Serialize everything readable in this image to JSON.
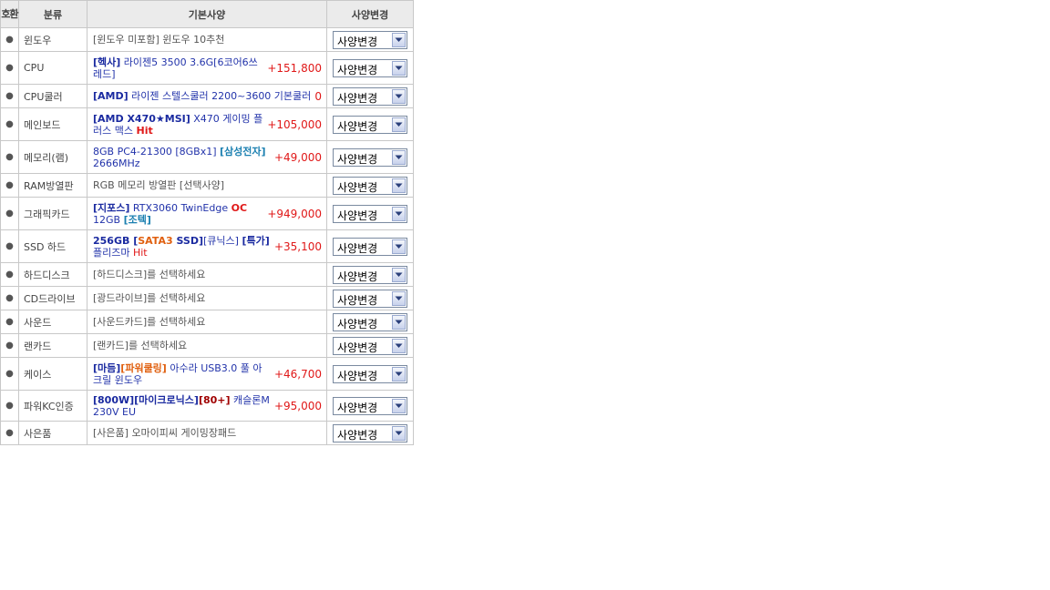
{
  "header": {
    "compat": "호환",
    "category": "분류",
    "spec": "기본사양",
    "change": "사양변경"
  },
  "dropdown_label": "사양변경",
  "bullet": "●",
  "rows": [
    {
      "category": "윈도우",
      "parts": [
        {
          "t": "[윈도우 미포함] 윈도우 10추천",
          "c": "gray"
        }
      ],
      "price": ""
    },
    {
      "category": "CPU",
      "parts": [
        {
          "t": "[헥사]",
          "c": "navy b"
        },
        {
          "t": " 라이젠5 3500 3.6G[6코어6쓰레드]",
          "c": ""
        }
      ],
      "price": "+151,800"
    },
    {
      "category": "CPU쿨러",
      "parts": [
        {
          "t": "[AMD]",
          "c": "navy b"
        },
        {
          "t": " 라이젠 스텔스쿨러 2200~3600 기본쿨러",
          "c": ""
        }
      ],
      "price": "0"
    },
    {
      "category": "메인보드",
      "parts": [
        {
          "t": "[AMD X470",
          "c": "navy b"
        },
        {
          "t": "★",
          "c": "navy"
        },
        {
          "t": "MSI]",
          "c": "navy b"
        },
        {
          "t": " X470 게이밍 플러스 맥스 ",
          "c": ""
        },
        {
          "t": "Hit",
          "c": "red b"
        }
      ],
      "price": "+105,000"
    },
    {
      "category": "메모리(램)",
      "parts": [
        {
          "t": "8GB PC4-21300 [8GBx1] ",
          "c": ""
        },
        {
          "t": "[삼성전자]",
          "c": "teal b"
        },
        {
          "t": " 2666MHz",
          "c": ""
        }
      ],
      "price": "+49,000"
    },
    {
      "category": "RAM방열판",
      "parts": [
        {
          "t": "RGB 메모리 방열판 [선택사양]",
          "c": "gray"
        }
      ],
      "price": ""
    },
    {
      "category": "그래픽카드",
      "parts": [
        {
          "t": "[지포스]",
          "c": "navy b"
        },
        {
          "t": " RTX3060 TwinEdge ",
          "c": ""
        },
        {
          "t": "OC",
          "c": "red b"
        },
        {
          "t": " 12GB ",
          "c": ""
        },
        {
          "t": "[조텍]",
          "c": "teal b"
        }
      ],
      "price": "+949,000"
    },
    {
      "category": "SSD 하드",
      "parts": [
        {
          "t": "256GB [",
          "c": "navy b"
        },
        {
          "t": "SATA3",
          "c": "orange b"
        },
        {
          "t": " SSD]",
          "c": "navy b"
        },
        {
          "t": "[큐닉스] ",
          "c": ""
        },
        {
          "t": "[특가]",
          "c": "navy b"
        },
        {
          "t": " 플리즈마 ",
          "c": ""
        },
        {
          "t": "Hit",
          "c": "red"
        }
      ],
      "price": "+35,100"
    },
    {
      "category": "하드디스크",
      "parts": [
        {
          "t": "[하드디스크]를 선택하세요",
          "c": "gray"
        }
      ],
      "price": ""
    },
    {
      "category": "CD드라이브",
      "parts": [
        {
          "t": "[광드라이브]를 선택하세요",
          "c": "gray"
        }
      ],
      "price": ""
    },
    {
      "category": "사운드",
      "parts": [
        {
          "t": "[사운드카드]를 선택하세요",
          "c": "gray"
        }
      ],
      "price": ""
    },
    {
      "category": "랜카드",
      "parts": [
        {
          "t": "[랜카드]를 선택하세요",
          "c": "gray"
        }
      ],
      "price": ""
    },
    {
      "category": "케이스",
      "parts": [
        {
          "t": "[마듬]",
          "c": "navy b"
        },
        {
          "t": "[파워쿨링]",
          "c": "orange b"
        },
        {
          "t": " 아수라 USB3.0 풀 아크릴 윈도우",
          "c": ""
        }
      ],
      "price": "+46,700"
    },
    {
      "category": "파워KC인증",
      "parts": [
        {
          "t": "[800W][마이크로닉스]",
          "c": "navy b"
        },
        {
          "t": "[80+]",
          "c": "darkred b"
        },
        {
          "t": " 캐슬론M 230V EU",
          "c": ""
        }
      ],
      "price": "+95,000"
    },
    {
      "category": "사은품",
      "parts": [
        {
          "t": "[사은품] 오마이피씨 게이밍장패드",
          "c": "gray"
        }
      ],
      "price": ""
    }
  ]
}
